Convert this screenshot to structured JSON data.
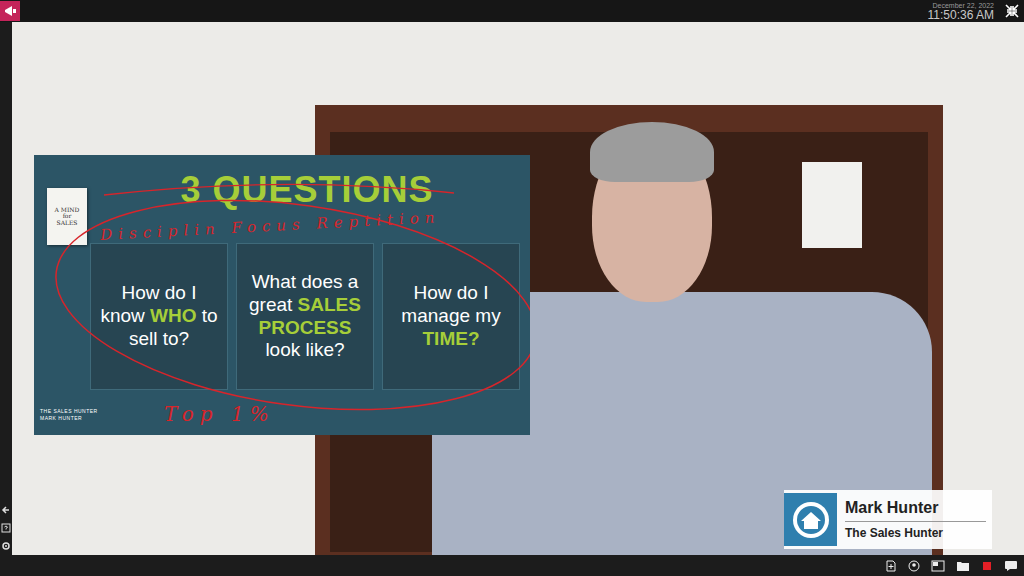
{
  "top_bar": {
    "date": "December 22, 2022",
    "time": "11:50:36 AM"
  },
  "slide": {
    "title": "3 QUESTIONS",
    "book": [
      "A MIND",
      "for",
      "SALES"
    ],
    "logo": [
      "THE SALES HUNTER",
      "MARK HUNTER"
    ],
    "cards": [
      {
        "before": "How do I know ",
        "highlight": "WHO",
        "after": " to sell to?"
      },
      {
        "before": "What does a great ",
        "highlight": "SALES PROCESS",
        "after": " look like?"
      },
      {
        "before": "How do I manage my ",
        "highlight": "TIME?"
      }
    ],
    "annotations": [
      "Disciplin Focus Reptition",
      "Top 1%"
    ]
  },
  "name_tag": {
    "name": "Mark Hunter",
    "subtitle": "The Sales Hunter"
  }
}
